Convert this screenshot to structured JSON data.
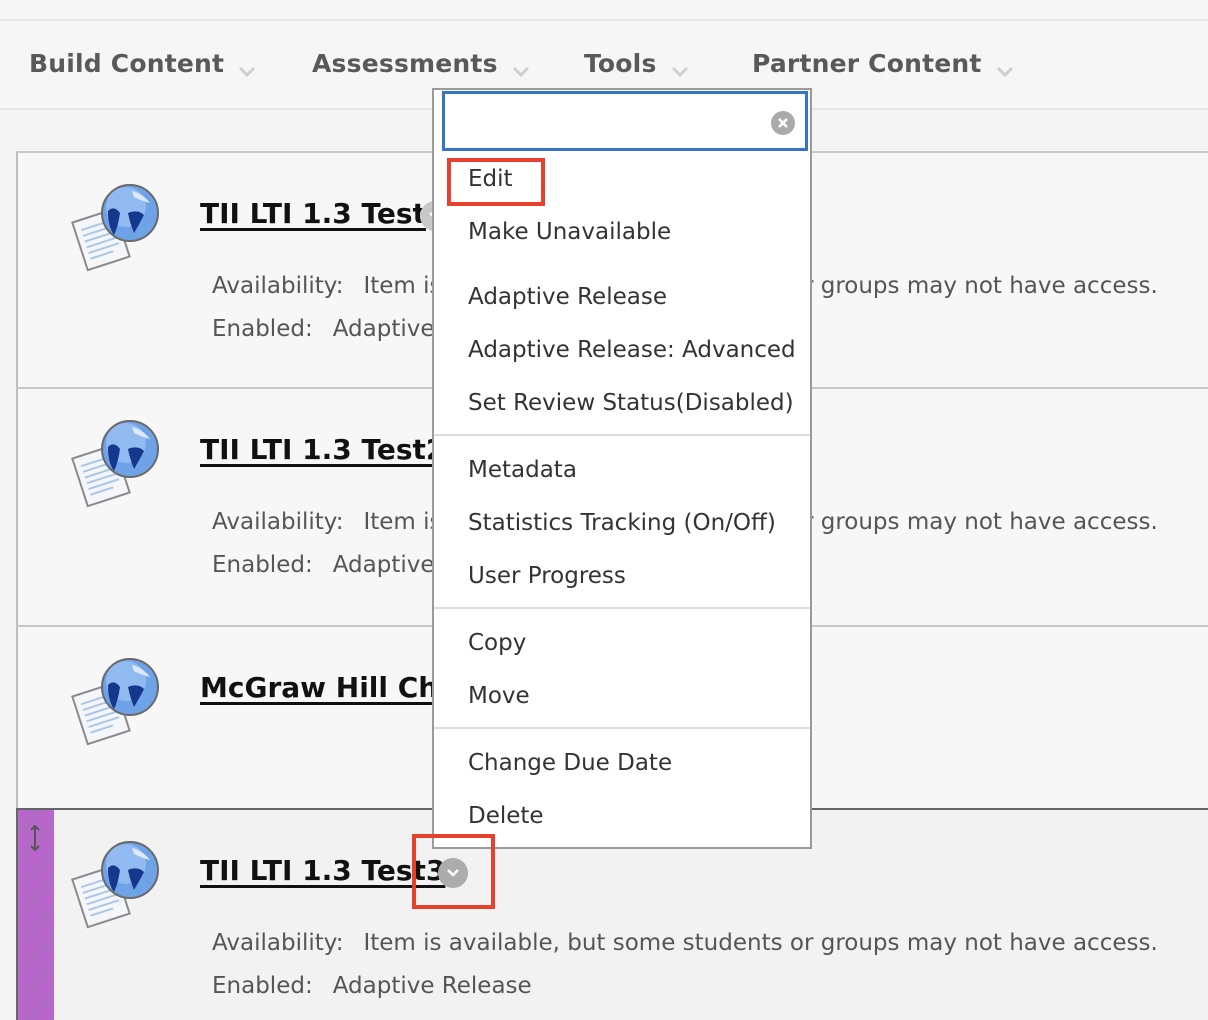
{
  "action_bar": {
    "menus": [
      {
        "label": "Build Content",
        "icon": "chevron-down-icon"
      },
      {
        "label": "Assessments",
        "icon": "chevron-down-icon"
      },
      {
        "label": "Tools",
        "icon": "chevron-down-icon"
      },
      {
        "label": "Partner Content",
        "icon": "chevron-down-icon"
      }
    ]
  },
  "content_items": [
    {
      "title": "TII LTI 1.3 Test",
      "icon": "web-link-globe-document-icon",
      "availability_label": "Availability:",
      "availability_value": "Item is available, but some students or groups may not have access.",
      "enabled_label": "Enabled:",
      "enabled_value": "Adaptive Release"
    },
    {
      "title": "TII LTI 1.3 Test2",
      "icon": "web-link-globe-document-icon",
      "availability_label": "Availability:",
      "availability_value": "Item is available, but some students or groups may not have access.",
      "enabled_label": "Enabled:",
      "enabled_value": "Adaptive Release"
    },
    {
      "title": "McGraw Hill Ch",
      "icon": "web-link-globe-document-icon"
    },
    {
      "title": "TII LTI 1.3 Test3",
      "icon": "web-link-globe-document-icon",
      "availability_label": "Availability:",
      "availability_value": "Item is available, but some students or groups may not have access.",
      "enabled_label": "Enabled:",
      "enabled_value": "Adaptive Release",
      "active": true
    }
  ],
  "context_menu": {
    "search_value": "",
    "items": [
      "Edit",
      "Make Unavailable",
      "Adaptive Release",
      "Adaptive Release: Advanced",
      "Set Review Status(Disabled)",
      "Metadata",
      "Statistics Tracking (On/Off)",
      "User Progress",
      "Copy",
      "Move",
      "Change Due Date",
      "Delete"
    ]
  },
  "colors": {
    "highlight": "#e5412d",
    "search_focus": "#3674c8",
    "drag_handle": "#b866cc"
  }
}
